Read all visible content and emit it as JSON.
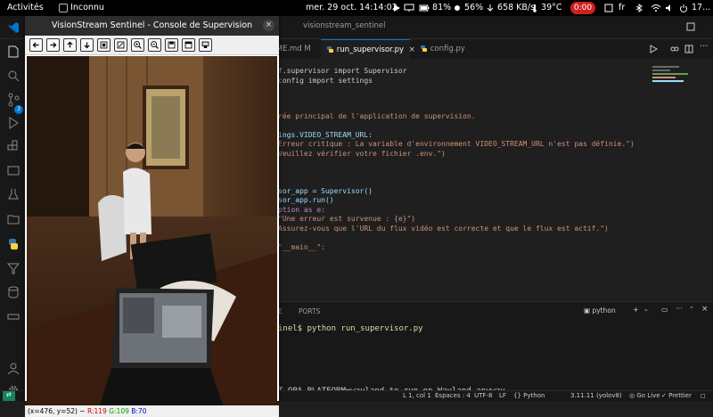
{
  "topbar": {
    "activities": "Activités",
    "app_name": "Inconnu",
    "datetime": "mer. 29 oct.  14:14:02",
    "battery": "81%",
    "brightness": "56%",
    "network_speed": "658 KB/s",
    "temperature": "39°C",
    "recording_time": "0:00",
    "language": "fr",
    "clock_right": "17..."
  },
  "vscode": {
    "window_title": "visionstream_sentinel",
    "tabs": [
      {
        "label": "README.md M"
      },
      {
        "label": "run_supervisor.py"
      },
      {
        "label": "config.py"
      }
    ],
    "code_lines": [
      {
        "text": ".supervisor import Supervisor"
      },
      {
        "text": "onfig import settings"
      },
      {
        "text": "rée principal de l'application de supervision."
      },
      {
        "text": "ings.VIDEO_STREAM_URL:"
      },
      {
        "text": "Erreur critique : La variable d'environnement VIDEO_STREAM_URL n'est pas définie.\")"
      },
      {
        "text": "Veuillez vérifier votre fichier .env.\")"
      },
      {
        "text": "sor_app = Supervisor()"
      },
      {
        "text": "sor_app.run()"
      },
      {
        "text": "ption as e:"
      },
      {
        "text": "\"Une erreur est survenue : {e}\")"
      },
      {
        "text": "Assurez-vous que l'URL du flux vidéo est correcte et que le flux est actif.\")"
      },
      {
        "text": "\"__main__\":"
      }
    ],
    "panel_tabs": [
      "E",
      "PORTS"
    ],
    "terminal_name": "python",
    "terminal_lines": [
      {
        "text": "inel$ python run_supervisor.py"
      },
      {
        "text": "T_QPA_PLATFORM=wayland to run on Wayland anyway."
      }
    ],
    "status": {
      "position": "L 1, col 1",
      "spaces": "Espaces : 4",
      "encoding": "UTF-8",
      "eol": "LF",
      "language": "Python",
      "interpreter": "3.11.11 (yolov8)",
      "golive": "Go Live",
      "prettier": "Prettier"
    },
    "badge_count": "3"
  },
  "cv_window": {
    "title": "VisionStream Sentinel - Console de Supervision",
    "toolbar_icons": [
      "arrow-left-icon",
      "arrow-right-icon",
      "arrow-up-icon",
      "arrow-down-icon",
      "zoom-fit-icon",
      "zoom-original-icon",
      "zoom-in-icon",
      "zoom-out-icon",
      "save-icon",
      "properties-icon",
      "options-icon"
    ],
    "status": {
      "coords": "(x=476, y=52) ~ ",
      "r": "R:119",
      "g": "G:109",
      "b": "B:70"
    }
  }
}
